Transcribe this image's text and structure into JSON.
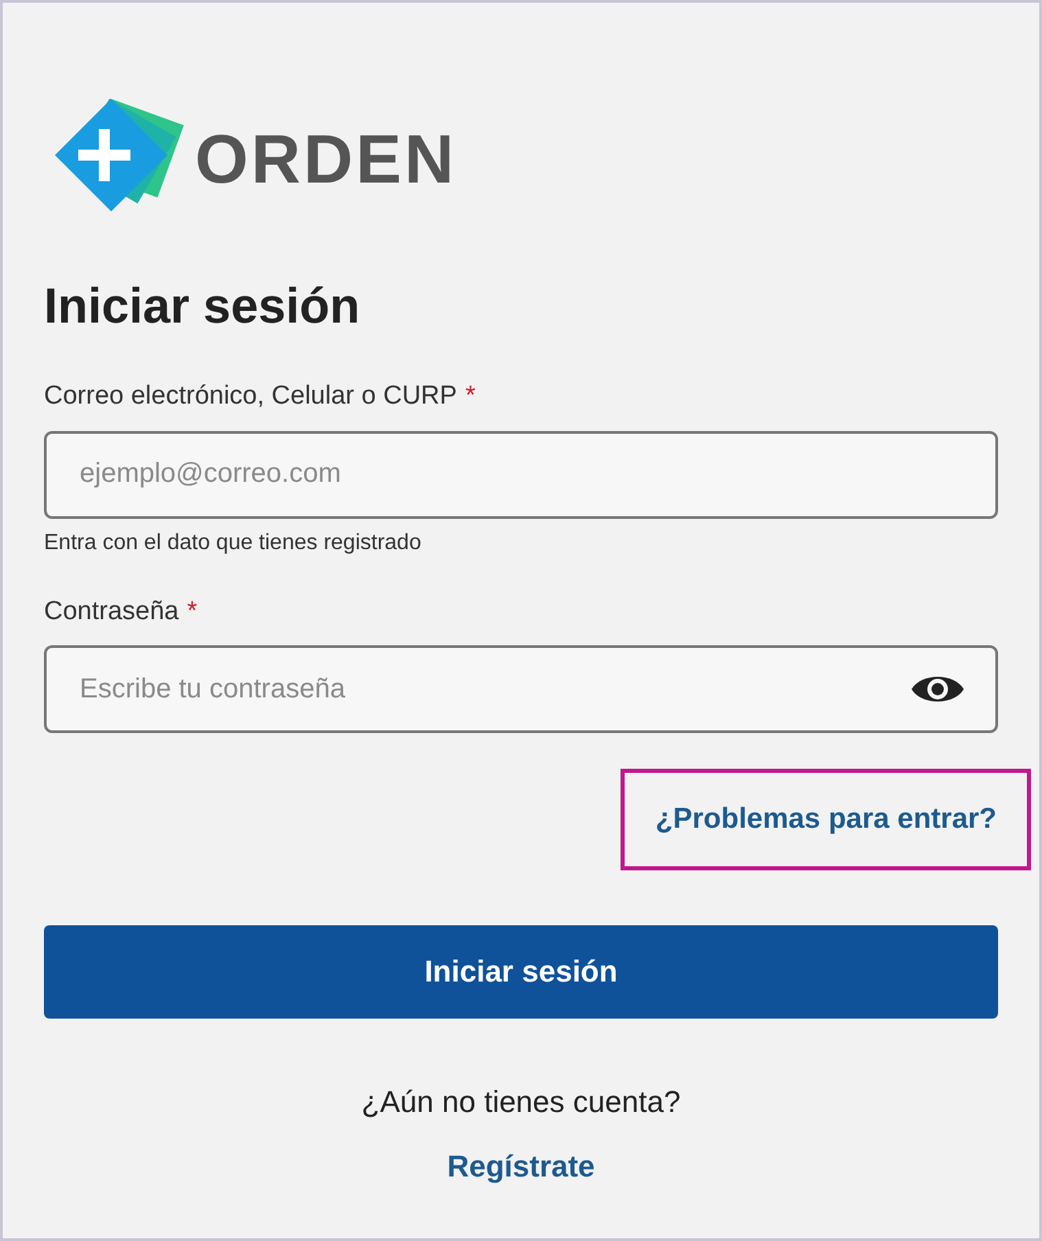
{
  "logo": {
    "text": "ORDEN"
  },
  "heading": "Iniciar sesión",
  "fields": [
    {
      "label": "Correo electrónico, Celular o CURP",
      "required": true,
      "placeholder": "ejemplo@correo.com",
      "hint": "Entra con el dato que tienes registrado",
      "kind": "text"
    },
    {
      "label": "Contraseña",
      "required": true,
      "placeholder": "Escribe tu contraseña",
      "kind": "password"
    }
  ],
  "required_mark": "*",
  "help_link": {
    "text": "¿Problemas para entrar?",
    "highlighted": true
  },
  "submit_button": "Iniciar sesión",
  "signup_prompt": "¿Aún no tienes cuenta?",
  "signup_link": "Regístrate"
}
